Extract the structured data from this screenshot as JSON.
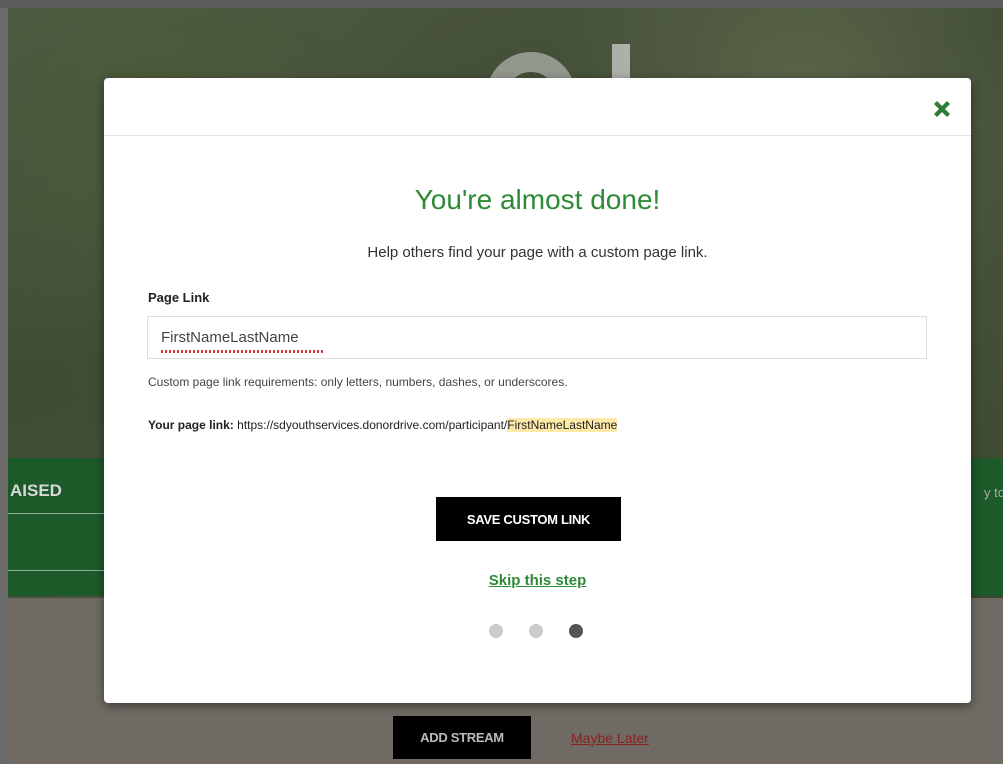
{
  "background": {
    "raised_label": "AISED",
    "right_snippet": "y tov",
    "add_stream_label": "ADD STREAM",
    "maybe_later_label": "Maybe Later"
  },
  "modal": {
    "title": "You're almost done!",
    "subtitle": "Help others find your page with a custom page link.",
    "field_label": "Page Link",
    "input_value": "FirstNameLastName",
    "requirements": "Custom page link requirements: only letters, numbers, dashes, or underscores.",
    "page_link_label": "Your page link:",
    "page_link_base": "https://sdyouthservices.donordrive.com/participant/",
    "page_link_slug": "FirstNameLastName",
    "save_label": "SAVE CUSTOM LINK",
    "skip_label": "Skip this step",
    "steps_total": 3,
    "current_step": 3
  },
  "colors": {
    "accent_green": "#2e8a36",
    "close_icon": "#2a7d33",
    "slug_highlight": "#fde9a8"
  },
  "icons": {
    "close": "close-x-icon"
  }
}
